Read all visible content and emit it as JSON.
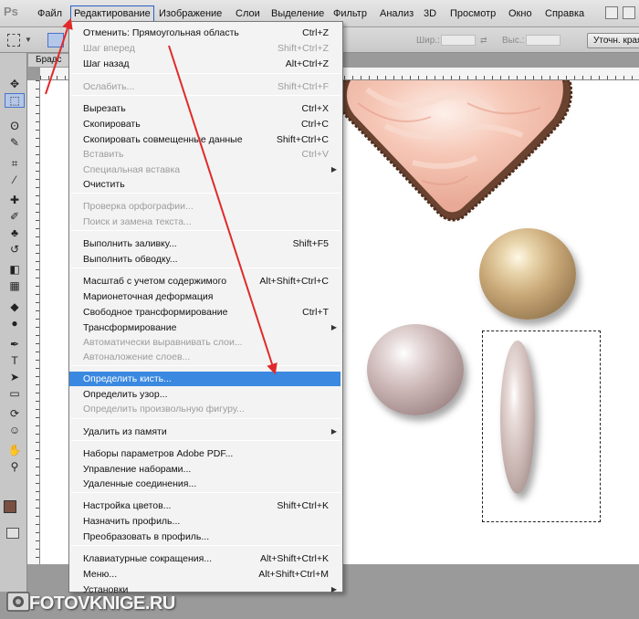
{
  "app": {
    "logo": "Ps"
  },
  "menubar": {
    "items": [
      "Файл",
      "Редактирование",
      "Изображение",
      "Слои",
      "Выделение",
      "Фильтр",
      "Анализ",
      "3D",
      "Просмотр",
      "Окно",
      "Справка"
    ],
    "active_index": 1
  },
  "options_bar": {
    "width_label": "Шир.:",
    "height_label": "Выс.:",
    "refine_edge_label": "Уточн. края"
  },
  "document": {
    "tab_title": "Брадс"
  },
  "edit_menu": {
    "items": [
      {
        "label": "Отменить: Прямоугольная область",
        "shortcut": "Ctrl+Z",
        "enabled": true
      },
      {
        "label": "Шаг вперед",
        "shortcut": "Shift+Ctrl+Z",
        "enabled": false
      },
      {
        "label": "Шаг назад",
        "shortcut": "Alt+Ctrl+Z",
        "enabled": true
      },
      {
        "label": "Ослабить...",
        "shortcut": "Shift+Ctrl+F",
        "enabled": false
      },
      {
        "label": "Вырезать",
        "shortcut": "Ctrl+X",
        "enabled": true
      },
      {
        "label": "Скопировать",
        "shortcut": "Ctrl+C",
        "enabled": true
      },
      {
        "label": "Скопировать совмещенные данные",
        "shortcut": "Shift+Ctrl+C",
        "enabled": true
      },
      {
        "label": "Вставить",
        "shortcut": "Ctrl+V",
        "enabled": false
      },
      {
        "label": "Специальная вставка",
        "shortcut": "",
        "enabled": false,
        "submenu": true
      },
      {
        "label": "Очистить",
        "shortcut": "",
        "enabled": true
      },
      {
        "label": "Проверка орфографии...",
        "shortcut": "",
        "enabled": false
      },
      {
        "label": "Поиск и замена текста...",
        "shortcut": "",
        "enabled": false
      },
      {
        "label": "Выполнить заливку...",
        "shortcut": "Shift+F5",
        "enabled": true
      },
      {
        "label": "Выполнить обводку...",
        "shortcut": "",
        "enabled": true
      },
      {
        "label": "Масштаб с учетом содержимого",
        "shortcut": "Alt+Shift+Ctrl+C",
        "enabled": true
      },
      {
        "label": "Марионеточная деформация",
        "shortcut": "",
        "enabled": true
      },
      {
        "label": "Свободное трансформирование",
        "shortcut": "Ctrl+T",
        "enabled": true
      },
      {
        "label": "Трансформирование",
        "shortcut": "",
        "enabled": true,
        "submenu": true
      },
      {
        "label": "Автоматически выравнивать слои...",
        "shortcut": "",
        "enabled": false
      },
      {
        "label": "Автоналожение слоев...",
        "shortcut": "",
        "enabled": false
      },
      {
        "label": "Определить кисть...",
        "shortcut": "",
        "enabled": true,
        "highlighted": true
      },
      {
        "label": "Определить узор...",
        "shortcut": "",
        "enabled": true
      },
      {
        "label": "Определить произвольную фигуру...",
        "shortcut": "",
        "enabled": false
      },
      {
        "label": "Удалить из памяти",
        "shortcut": "",
        "enabled": true,
        "submenu": true
      },
      {
        "label": "Наборы параметров Adobe PDF...",
        "shortcut": "",
        "enabled": true
      },
      {
        "label": "Управление наборами...",
        "shortcut": "",
        "enabled": true
      },
      {
        "label": "Удаленные соединения...",
        "shortcut": "",
        "enabled": true
      },
      {
        "label": "Настройка цветов...",
        "shortcut": "Shift+Ctrl+K",
        "enabled": true
      },
      {
        "label": "Назначить профиль...",
        "shortcut": "",
        "enabled": true
      },
      {
        "label": "Преобразовать в профиль...",
        "shortcut": "",
        "enabled": true
      },
      {
        "label": "Клавиатурные сокращения...",
        "shortcut": "Alt+Shift+Ctrl+K",
        "enabled": true
      },
      {
        "label": "Меню...",
        "shortcut": "Alt+Shift+Ctrl+M",
        "enabled": true
      },
      {
        "label": "Установки",
        "shortcut": "",
        "enabled": true,
        "submenu": true
      }
    ]
  },
  "tools": {
    "icons": [
      "move-tool-icon",
      "marquee-tool-icon",
      "lasso-tool-icon",
      "quick-select-tool-icon",
      "crop-tool-icon",
      "eyedropper-tool-icon",
      "healing-brush-tool-icon",
      "brush-tool-icon",
      "clone-stamp-tool-icon",
      "history-brush-tool-icon",
      "eraser-tool-icon",
      "gradient-tool-icon",
      "blur-tool-icon",
      "dodge-tool-icon",
      "pen-tool-icon",
      "type-tool-icon",
      "path-select-tool-icon",
      "shape-tool-icon",
      "3d-rotate-tool-icon",
      "3d-orbit-tool-icon",
      "hand-tool-icon",
      "zoom-tool-icon"
    ],
    "glyphs": [
      "✥",
      "⬚",
      "ʘ",
      "✎",
      "⌗",
      "⁄",
      "✚",
      "✐",
      "♣",
      "↺",
      "◧",
      "▦",
      "◆",
      "●",
      "✒",
      "T",
      "➤",
      "▭",
      "⟳",
      "☺",
      "✋",
      "⚲"
    ],
    "foreground_color": "#7a5042",
    "background_color": "#ffffff"
  },
  "watermark": {
    "text": "FOTOVKNIGE.RU"
  },
  "colors": {
    "menu_highlight": "#3a88e0",
    "annotation_arrow": "#e02a2a"
  }
}
